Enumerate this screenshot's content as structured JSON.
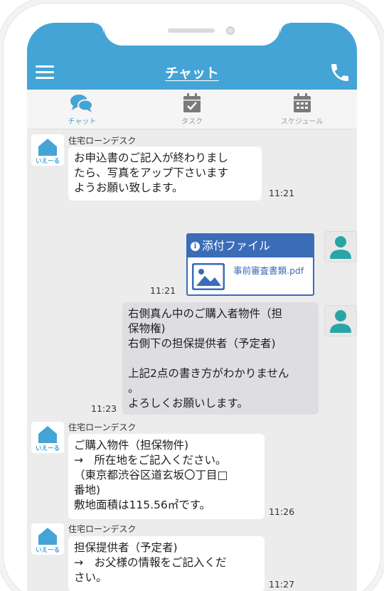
{
  "header": {
    "title": "チャット",
    "menu_icon": "hamburger-menu-icon",
    "phone_icon": "phone-icon",
    "color": "#44a4d6"
  },
  "tabs": [
    {
      "label": "チャット",
      "icon": "chat-bubbles-icon",
      "active": true
    },
    {
      "label": "タスク",
      "icon": "calendar-check-icon",
      "active": false
    },
    {
      "label": "スケジュール",
      "icon": "calendar-icon",
      "active": false
    }
  ],
  "logo": {
    "text": "いえーる"
  },
  "messages": [
    {
      "sender": "住宅ローンデスク",
      "text": "お申込書のご記入が終わりまし\nたら、写真をアップ下さいます\nようお願い致します。",
      "time": "11:21"
    },
    {
      "attachment": {
        "title": "添付ファイル",
        "filename": "事前審査書類.pdf"
      },
      "time": "11:21"
    },
    {
      "text": "右側真ん中のご購入者物件（担\n保物権)\n右側下の担保提供者（予定者)\n\n上記2点の書き方がわかりません\n。\nよろしくお願いします。",
      "time": "11:23"
    },
    {
      "sender": "住宅ローンデスク",
      "text": "ご購入物件（担保物件)\n→　所在地をご記入ください。\n（東京都渋谷区道玄坂〇丁目□\n番地)\n敷地面積は115.56㎡です。",
      "time": "11:26"
    },
    {
      "sender": "住宅ローンデスク",
      "text": "担保提供者（予定者)\n→　お父様の情報をご記入くだ\nさい。",
      "time": "11:27"
    }
  ]
}
